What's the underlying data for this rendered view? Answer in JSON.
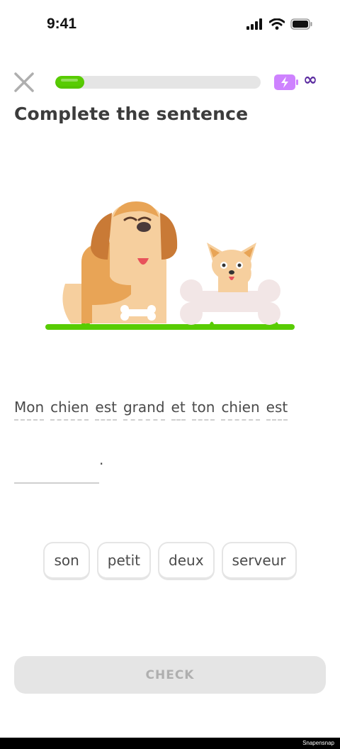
{
  "status_bar": {
    "time": "9:41"
  },
  "header": {
    "progress_fraction": 0.14,
    "energy_symbol": "∞"
  },
  "title": "Complete the sentence",
  "sentence": {
    "words": [
      "Mon",
      "chien",
      "est",
      "grand",
      "et",
      "ton",
      "chien",
      "est"
    ],
    "end_punctuation": "."
  },
  "word_bank": [
    "son",
    "petit",
    "deux",
    "serveur"
  ],
  "check_label": "CHECK",
  "footer": {
    "watermark": "Snapensnap"
  },
  "colors": {
    "progress_fill": "#58cc02",
    "energy": "#ce82ff",
    "infinity": "#5b2ca0",
    "grass": "#58cc02",
    "check_disabled_bg": "#e5e5e5"
  },
  "icons": [
    "close-icon",
    "signal-icon",
    "wifi-icon",
    "battery-icon",
    "energy-icon",
    "infinity-icon"
  ]
}
